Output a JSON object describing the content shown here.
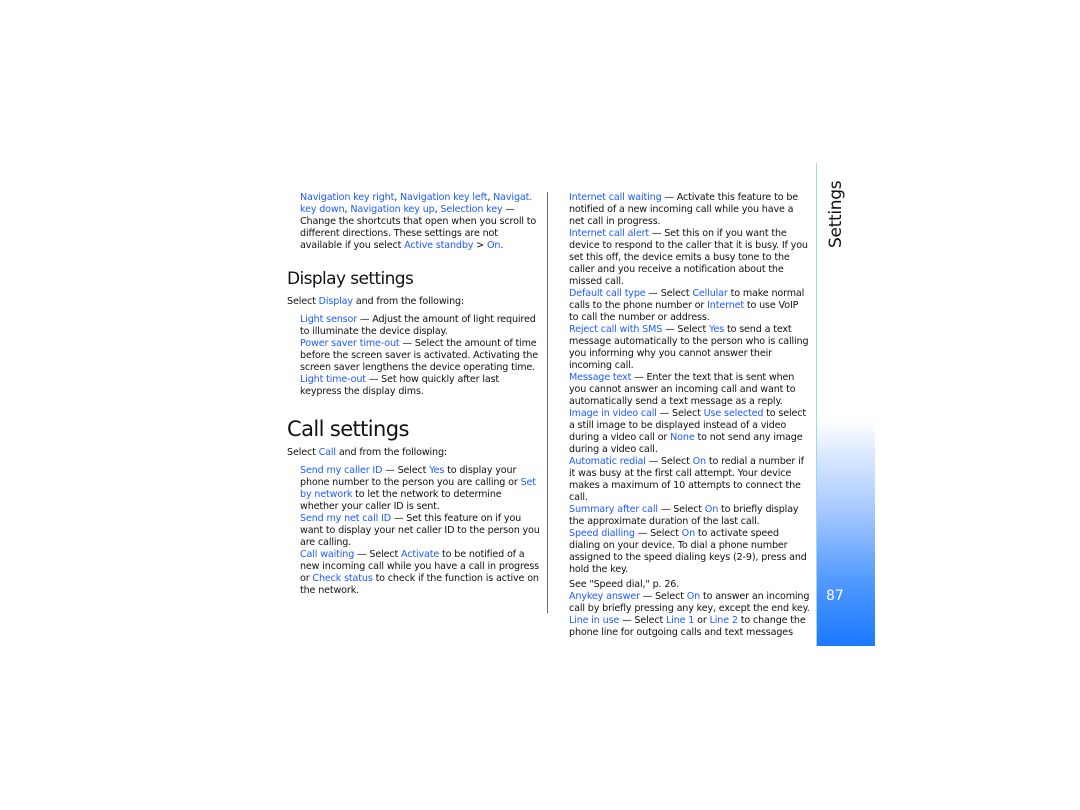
{
  "document": {
    "page_number": "87",
    "side_tab_title": "Settings",
    "left_column": {
      "top_entry": {
        "segments": [
          {
            "text": "Navigation key right",
            "link": true
          },
          {
            "text": ", ",
            "link": false
          },
          {
            "text": "Navigation key left",
            "link": true
          },
          {
            "text": ", ",
            "link": false
          },
          {
            "text": "Navigat. key down",
            "link": true
          },
          {
            "text": ", ",
            "link": false
          },
          {
            "text": "Navigation key up",
            "link": true
          },
          {
            "text": ", ",
            "link": false
          },
          {
            "text": "Selection key",
            "link": true
          },
          {
            "text": " — Change the shortcuts that open when you scroll to different directions. These settings are not available if you select ",
            "link": false
          },
          {
            "text": "Active standby",
            "link": true
          },
          {
            "text": " > ",
            "link": false
          },
          {
            "text": "On",
            "link": true
          },
          {
            "text": ".",
            "link": false
          }
        ]
      },
      "display_settings": {
        "heading": "Display settings",
        "intro": [
          {
            "text": "Select ",
            "link": false
          },
          {
            "text": "Display",
            "link": true
          },
          {
            "text": " and from the following:",
            "link": false
          }
        ],
        "entries": [
          [
            {
              "text": "Light sensor",
              "link": true
            },
            {
              "text": " — Adjust the amount of light required to illuminate the device display.",
              "link": false
            }
          ],
          [
            {
              "text": "Power saver time-out",
              "link": true
            },
            {
              "text": " — Select the amount of time before the screen saver is activated. Activating the screen saver lengthens the device operating time.",
              "link": false
            }
          ],
          [
            {
              "text": "Light time-out",
              "link": true
            },
            {
              "text": " — Set how quickly after last keypress the display dims.",
              "link": false
            }
          ]
        ]
      },
      "call_settings": {
        "heading": "Call settings",
        "intro": [
          {
            "text": "Select ",
            "link": false
          },
          {
            "text": "Call",
            "link": true
          },
          {
            "text": " and from the following:",
            "link": false
          }
        ],
        "entries": [
          [
            {
              "text": "Send my caller ID",
              "link": true
            },
            {
              "text": " — Select ",
              "link": false
            },
            {
              "text": "Yes",
              "link": true
            },
            {
              "text": " to display your phone number to the person you are calling or ",
              "link": false
            },
            {
              "text": "Set by network",
              "link": true
            },
            {
              "text": " to let the network to determine whether your caller ID is sent.",
              "link": false
            }
          ],
          [
            {
              "text": "Send my net call ID",
              "link": true
            },
            {
              "text": " — Set this feature on if you want to display your net caller ID to the person you are calling.",
              "link": false
            }
          ],
          [
            {
              "text": "Call waiting",
              "link": true
            },
            {
              "text": " — Select ",
              "link": false
            },
            {
              "text": "Activate",
              "link": true
            },
            {
              "text": " to be notified of a new incoming call while you have a call in progress or ",
              "link": false
            },
            {
              "text": "Check status",
              "link": true
            },
            {
              "text": " to check if the function is active on the network.",
              "link": false
            }
          ]
        ]
      }
    },
    "middle_column": {
      "entries": [
        [
          {
            "text": "Internet call waiting",
            "link": true
          },
          {
            "text": " — Activate this feature to be notified of a new incoming call while you have a net call in progress.",
            "link": false
          }
        ],
        [
          {
            "text": "Internet call alert",
            "link": true
          },
          {
            "text": " — Set this on if you want the device to respond to the caller that it is busy. If you set this off, the device emits a busy tone to the caller and you receive a notification about the missed call.",
            "link": false
          }
        ],
        [
          {
            "text": "Default call type",
            "link": true
          },
          {
            "text": " — Select ",
            "link": false
          },
          {
            "text": "Cellular",
            "link": true
          },
          {
            "text": " to make normal calls to the phone number or ",
            "link": false
          },
          {
            "text": "Internet",
            "link": true
          },
          {
            "text": " to use VoIP to call the number or address.",
            "link": false
          }
        ],
        [
          {
            "text": "Reject call with SMS",
            "link": true
          },
          {
            "text": " — Select ",
            "link": false
          },
          {
            "text": "Yes",
            "link": true
          },
          {
            "text": " to send a text message automatically to the person who is calling you informing why you cannot answer their incoming call.",
            "link": false
          }
        ],
        [
          {
            "text": "Message text",
            "link": true
          },
          {
            "text": " — Enter the text that is sent when you cannot answer an incoming call and want to automatically send a text message as a reply.",
            "link": false
          }
        ],
        [
          {
            "text": "Image in video call",
            "link": true
          },
          {
            "text": " — Select ",
            "link": false
          },
          {
            "text": "Use selected",
            "link": true
          },
          {
            "text": " to select a still image to be displayed instead of a video during a video call or ",
            "link": false
          },
          {
            "text": "None",
            "link": true
          },
          {
            "text": " to not send any image during a video call.",
            "link": false
          }
        ],
        [
          {
            "text": "Automatic redial",
            "link": true
          },
          {
            "text": " — Select ",
            "link": false
          },
          {
            "text": "On",
            "link": true
          },
          {
            "text": " to redial a number if it was busy at the first call attempt. Your device makes a maximum of 10 attempts to connect the call.",
            "link": false
          }
        ],
        [
          {
            "text": "Summary after call",
            "link": true
          },
          {
            "text": " — Select ",
            "link": false
          },
          {
            "text": "On",
            "link": true
          },
          {
            "text": " to briefly display the approximate duration of the last call.",
            "link": false
          }
        ],
        [
          {
            "text": "Speed dialling",
            "link": true
          },
          {
            "text": " — Select ",
            "link": false
          },
          {
            "text": "On",
            "link": true
          },
          {
            "text": " to activate speed dialing on your device. To dial a phone number assigned to the speed dialing keys (2-9), press and hold the key.",
            "link": false
          }
        ]
      ],
      "see_also": "See \"Speed dial,\" p. 26.",
      "entries_after": [
        [
          {
            "text": "Anykey answer",
            "link": true
          },
          {
            "text": " — Select ",
            "link": false
          },
          {
            "text": "On",
            "link": true
          },
          {
            "text": " to answer an incoming call by briefly pressing any key, except the end key.",
            "link": false
          }
        ],
        [
          {
            "text": "Line in use",
            "link": true
          },
          {
            "text": " — Select ",
            "link": false
          },
          {
            "text": "Line 1",
            "link": true
          },
          {
            "text": " or ",
            "link": false
          },
          {
            "text": "Line 2",
            "link": true
          },
          {
            "text": " to change the phone line for outgoing calls and text messages",
            "link": false
          }
        ]
      ]
    },
    "colors": {
      "link": "#1e5bff",
      "text": "#111111",
      "tab_blue": "#1a79ff",
      "tab_line": "#9fd4ff",
      "divider": "#6a6a6a"
    }
  }
}
